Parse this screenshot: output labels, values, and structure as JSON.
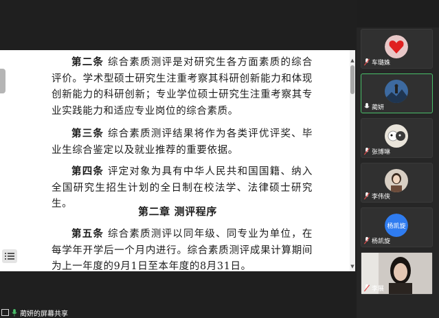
{
  "document": {
    "p1_art": "第二条",
    "p1_text": "综合素质测评是对研究生各方面素质的综合评价。学术型硕士研究生注重考察其科研创新能力和体现创新能力的科研创新；专业学位硕士研究生注重考察其专业实践能力和适应专业岗位的综合素质。",
    "p2_art": "第三条",
    "p2_text": "综合素质测评结果将作为各类评优评奖、毕业生综合鉴定以及就业推荐的重要依据。",
    "p3_art": "第四条",
    "p3_text": "评定对象为具有中华人民共和国国籍、纳入全国研究生招生计划的全日制在校法学、法律硕士研究生。",
    "chapter": "第二章  测评程序",
    "p4_art": "第五条",
    "p4_text": "综合素质测评以同年级、同专业为单位，在每学年开学后一个月内进行。综合素质测评成果计算期间为上一年度的9月1日至本年度的8月31日。"
  },
  "share": {
    "label": "蔺妍的屏幕共享"
  },
  "participants": [
    {
      "name": "车璐姝",
      "avatar": "red-heart-avatar",
      "speaking": false
    },
    {
      "name": "蔺妍",
      "avatar": "mountain-person-avatar",
      "speaking": true
    },
    {
      "name": "张博琳",
      "avatar": "animal-avatar",
      "speaking": false
    },
    {
      "name": "李伟侠",
      "avatar": "photo-avatar",
      "speaking": false
    },
    {
      "name": "杨凯旋",
      "avatar_text": "杨凯旋",
      "speaking": false
    },
    {
      "name": "李展",
      "avatar": "video-feed",
      "speaking": false
    }
  ],
  "colors": {
    "accent_active": "#4ac06a",
    "mic_muted": "#e04848",
    "avatar_blue": "#2f7cf0"
  }
}
